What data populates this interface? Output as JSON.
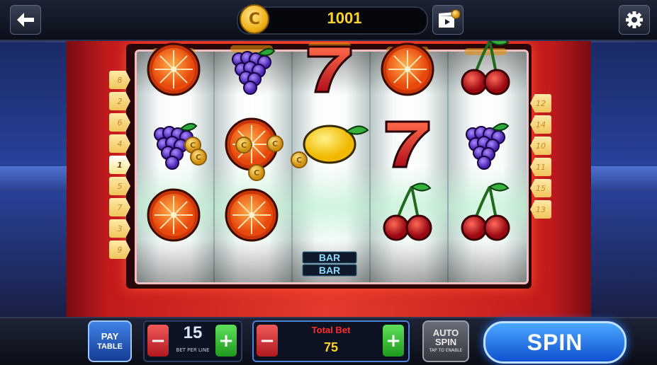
{
  "balance": {
    "value": "1001",
    "icon": "coin-icon"
  },
  "topbar": {
    "back_icon": "back-arrow-icon",
    "video_icon": "video-reward-icon",
    "settings_icon": "gear-icon",
    "coin_symbol": "C"
  },
  "paylines": {
    "left": [
      "8",
      "2",
      "6",
      "4",
      "1",
      "5",
      "7",
      "3",
      "9"
    ],
    "right": [
      "12",
      "14",
      "10",
      "11",
      "15",
      "13"
    ],
    "active": "1"
  },
  "reels": [
    [
      "orange",
      "grape",
      "orange"
    ],
    [
      "grape",
      "orange",
      "orange"
    ],
    [
      "seven",
      "lemon",
      "bar"
    ],
    [
      "orange",
      "seven",
      "cherry"
    ],
    [
      "cherry",
      "grape",
      "cherry"
    ]
  ],
  "bar_symbol_label": "BAR",
  "controls": {
    "pay_table_line1": "PAY",
    "pay_table_line2": "TABLE",
    "bet_per_line_value": "15",
    "bet_per_line_label": "BET PER LINE",
    "total_bet_label": "Total Bet",
    "total_bet_value": "75",
    "auto_spin_line1": "AUTO",
    "auto_spin_line2": "SPIN",
    "auto_spin_hint": "TAP TO ENABLE",
    "spin_label": "SPIN",
    "minus_symbol": "−",
    "plus_symbol": "+"
  },
  "colors": {
    "accent_gold": "#ffd32a",
    "frame_red": "#c21b1d",
    "spin_blue": "#1f6ee8"
  }
}
